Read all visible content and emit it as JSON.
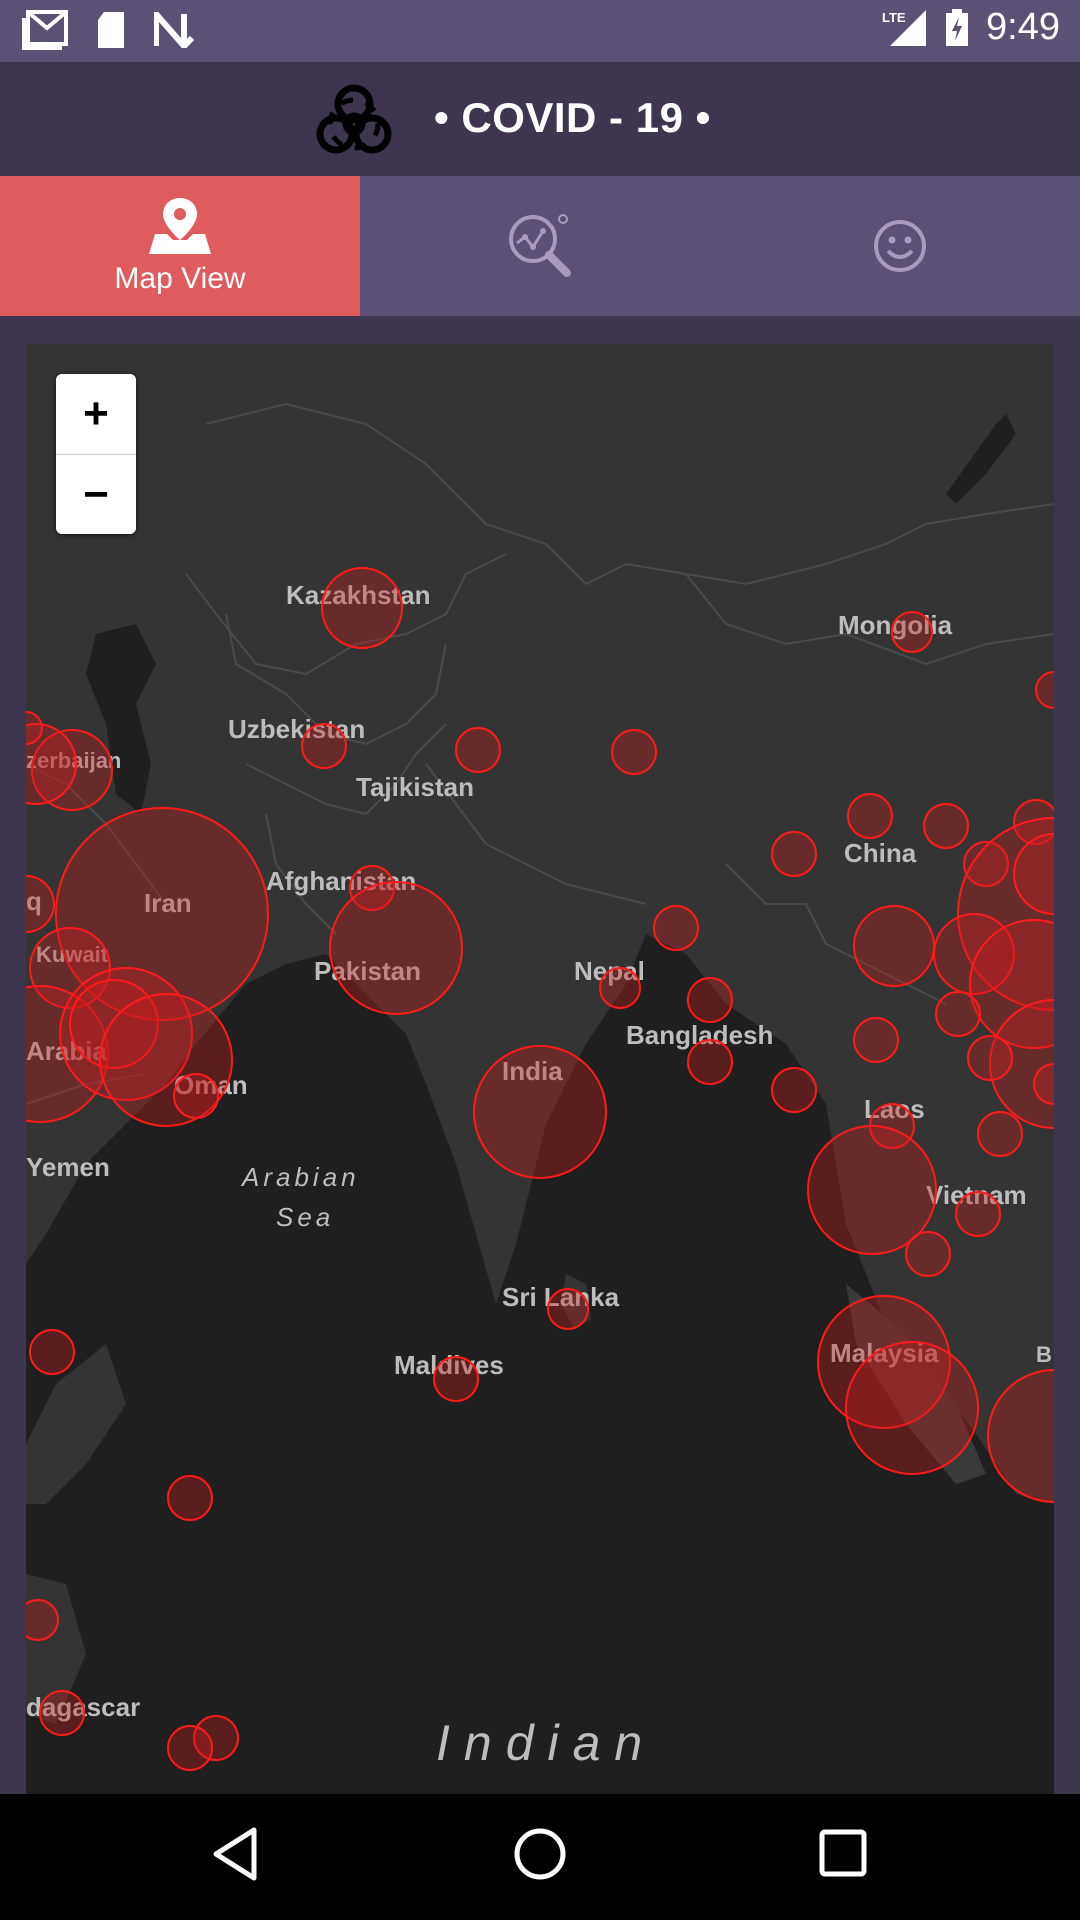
{
  "status_bar": {
    "time": "9:49",
    "network": "LTE"
  },
  "header": {
    "title": "• COVID - 19 •"
  },
  "tabs": [
    {
      "label": "Map View",
      "icon": "map-pin-icon",
      "active": true
    },
    {
      "label": "",
      "icon": "analytics-search-icon",
      "active": false
    },
    {
      "label": "",
      "icon": "smiley-icon",
      "active": false
    }
  ],
  "map": {
    "zoom_in_label": "+",
    "zoom_out_label": "−",
    "labels": {
      "kazakhstan": "Kazakhstan",
      "mongolia": "Mongolia",
      "uzbekistan": "Uzbekistan",
      "azerbaijan": "zerbaijan",
      "tajikistan": "Tajikistan",
      "china": "China",
      "afghanistan": "Afghanistan",
      "iran": "Iran",
      "iraq": "q",
      "kuwait": "Kuwait",
      "pakistan": "Pakistan",
      "nepal": "Nepal",
      "bangladesh": "Bangladesh",
      "arabia": "Arabia",
      "oman": "Oman",
      "india": "India",
      "laos": "Laos",
      "yemen": "Yemen",
      "arabian_sea_1": "Arabian",
      "arabian_sea_2": "Sea",
      "vietnam": "Vietnam",
      "sri_lanka": "Sri Lanka",
      "malaysia": "Malaysia",
      "maldives": "Maldives",
      "madagascar": "dagascar",
      "indian": "Indian",
      "edge_b": "B"
    },
    "marker_color": "#ff1a1a"
  },
  "colors": {
    "accent": "#e05b5b",
    "header": "#3e354f",
    "tabbar": "#5c5174",
    "map_land": "#343434",
    "map_water": "#1f1f1f"
  }
}
